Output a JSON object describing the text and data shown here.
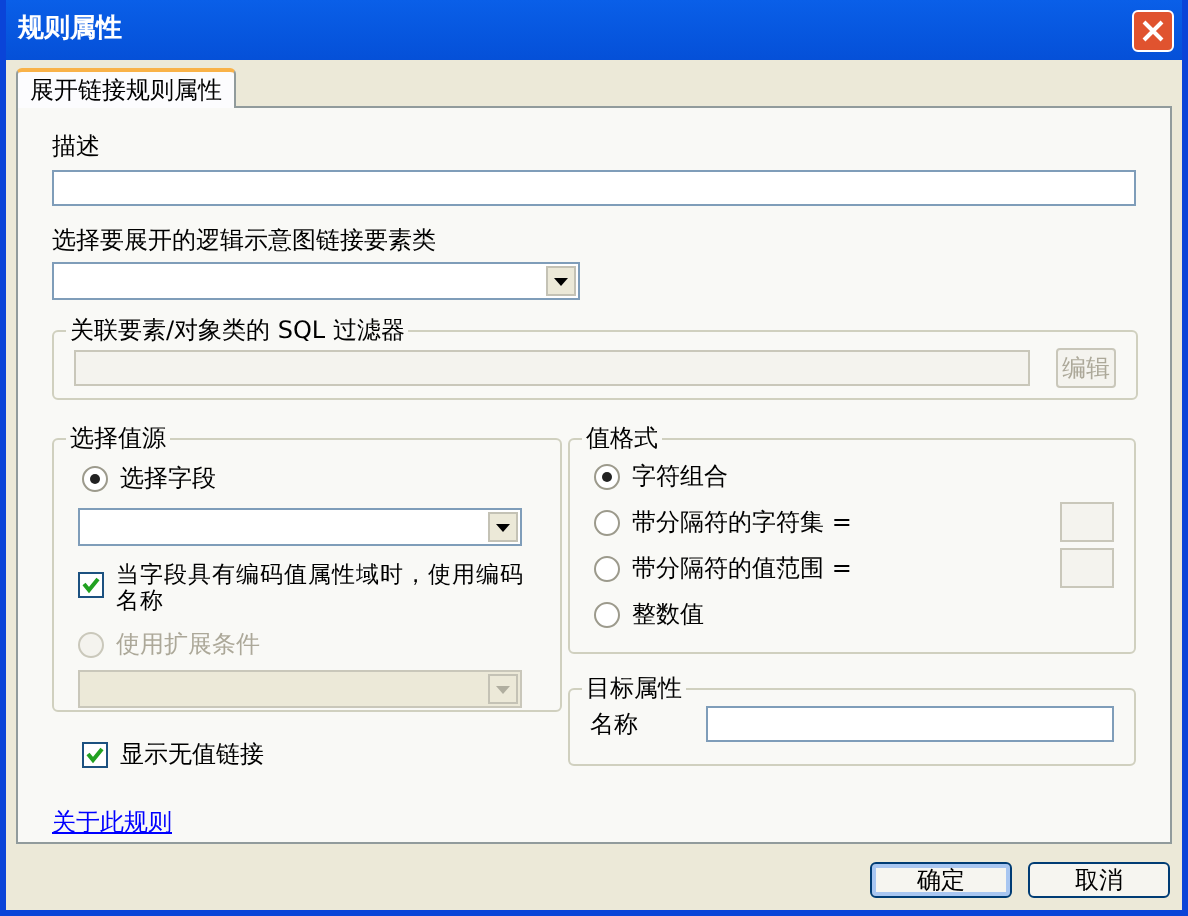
{
  "window": {
    "title": "规则属性"
  },
  "tabs": [
    {
      "label": "展开链接规则属性",
      "selected": true
    }
  ],
  "description": {
    "label": "描述"
  },
  "feature_class": {
    "label": "选择要展开的逻辑示意图链接要素类"
  },
  "sql_filter": {
    "title": "关联要素/对象类的 SQL 过滤器",
    "edit_button": {
      "label": "编辑",
      "disabled": true
    }
  },
  "value_source": {
    "title": "选择值源",
    "field_option": {
      "label": "选择字段",
      "selected": true,
      "disabled": false
    },
    "coded_checkbox": {
      "label": "当字段具有编码值属性域时，使用编码名称",
      "checked": true
    },
    "expression_option": {
      "label": "使用扩展条件",
      "selected": false,
      "disabled": true
    }
  },
  "value_format": {
    "title": "值格式",
    "options": [
      {
        "label": "字符组合",
        "selected": true,
        "kind": "plain"
      },
      {
        "label": "带分隔符的字符集 =",
        "selected": false,
        "kind": "with_field"
      },
      {
        "label": "带分隔符的值范围 =",
        "selected": false,
        "kind": "with_field"
      },
      {
        "label": "整数值",
        "selected": false,
        "kind": "plain"
      }
    ]
  },
  "target": {
    "title": "目标属性",
    "name_label": "名称"
  },
  "show_no_value_links": {
    "label": "显示无值链接",
    "checked": true
  },
  "about_link": "关于此规则",
  "buttons": [
    {
      "label": "确定",
      "default": true
    },
    {
      "label": "取消",
      "default": false
    }
  ]
}
